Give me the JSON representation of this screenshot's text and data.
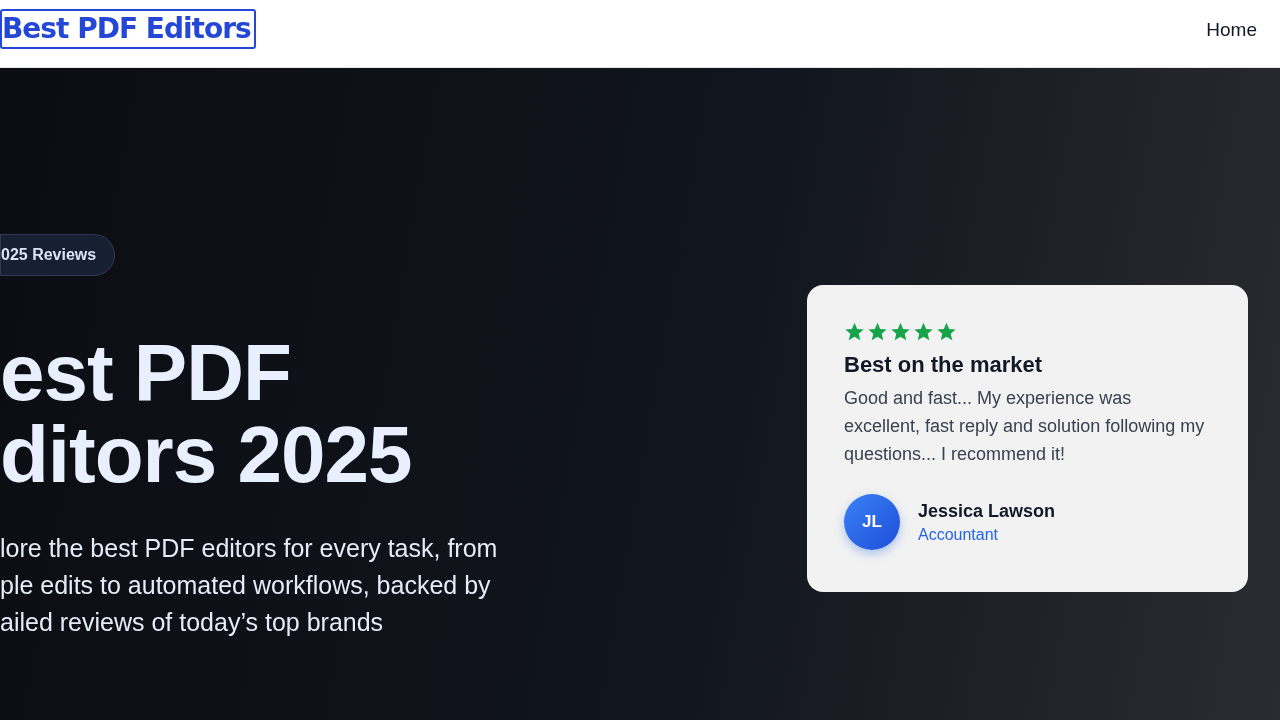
{
  "header": {
    "logo": "Best PDF Editors",
    "nav": [
      {
        "label": "Home"
      }
    ]
  },
  "hero": {
    "badge": "025 Reviews",
    "title_lines": [
      "est PDF",
      "ditors 2025"
    ],
    "description_lines": [
      "lore the best PDF editors for every task, from",
      "ple edits to automated workflows, backed by",
      "ailed reviews of today’s top brands"
    ]
  },
  "testimonial": {
    "stars": 5,
    "title": "Best on the market",
    "quote": "Good and fast... My experience was excellent, fast reply and solution following my questions... I recommend it!",
    "author": {
      "initials": "JL",
      "name": "Jessica Lawson",
      "role": "Accountant"
    }
  }
}
